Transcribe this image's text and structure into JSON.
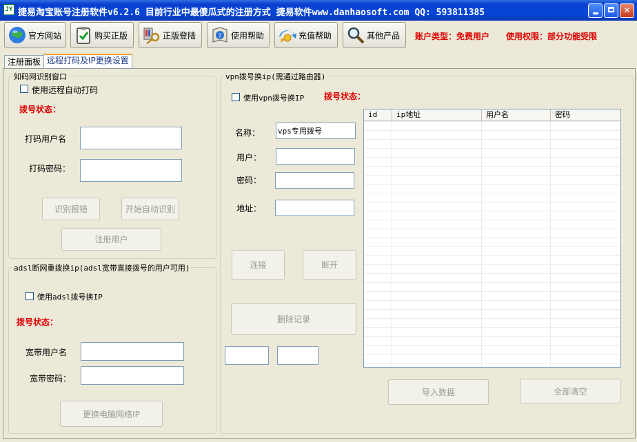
{
  "window": {
    "title": "捷易淘宝账号注册软件v6.2.6 目前行业中最傻瓜式的注册方式 捷易软件www.danhaosoft.com QQ: 593811385",
    "icon_text": "JY"
  },
  "toolbar": {
    "items": [
      {
        "label": "官方网站",
        "icon": "globe-icon"
      },
      {
        "label": "购买正版",
        "icon": "clipboard-check-icon"
      },
      {
        "label": "正版登陆",
        "icon": "key-login-icon"
      },
      {
        "label": "使用帮助",
        "icon": "help-book-icon"
      },
      {
        "label": "充值帮助",
        "icon": "recharge-icon"
      },
      {
        "label": "其他产品",
        "icon": "magnifier-icon"
      }
    ],
    "account_type": "账户类型：免费用户",
    "permission": "使用权限：部分功能受限"
  },
  "tabs": [
    {
      "label": "注册面板",
      "active": false
    },
    {
      "label": "远程打码及IP更换设置",
      "active": true
    }
  ],
  "captcha_group": {
    "title": "知码网识别窗口",
    "remote_checkbox_label": "使用远程自动打码",
    "remote_checked": false,
    "status_label": "拨号状态：",
    "user_label": "打码用户名",
    "user_value": "",
    "pass_label": "打码密码：",
    "pass_value": "",
    "report_error_button": "识别报错",
    "start_button": "开始自动识别",
    "register_button": "注册用户"
  },
  "adsl_group": {
    "title": "adsl断网重拨换ip(adsl宽带直接拨号的用户可用)",
    "checkbox_label": "使用adsl拨号换IP",
    "checked": false,
    "status_label": "拨号状态：",
    "user_label": "宽带用户名",
    "user_value": "",
    "pass_label": "宽带密码：",
    "pass_value": "",
    "change_ip_button": "更换电脑网络IP"
  },
  "vpn_group": {
    "title": "vpn拨号换ip(需通过路由器)",
    "checkbox_label": "使用vpn拨号换IP",
    "checked": false,
    "status_label": "拨号状态：",
    "name_label": "名称：",
    "name_value": "vps专用拨号",
    "user_label": "用户：",
    "user_value": "",
    "pass_label": "密码：",
    "pass_value": "",
    "addr_label": "地址：",
    "addr_value": "",
    "connect_button": "连接",
    "disconnect_button": "断开",
    "delete_button": "删除记录",
    "extra_field_1": "",
    "extra_field_2": "",
    "table": {
      "columns": [
        "id",
        "ip地址",
        "用户名",
        "密码"
      ],
      "rows": []
    },
    "import_button": "导入数据",
    "clear_button": "全部清空"
  }
}
